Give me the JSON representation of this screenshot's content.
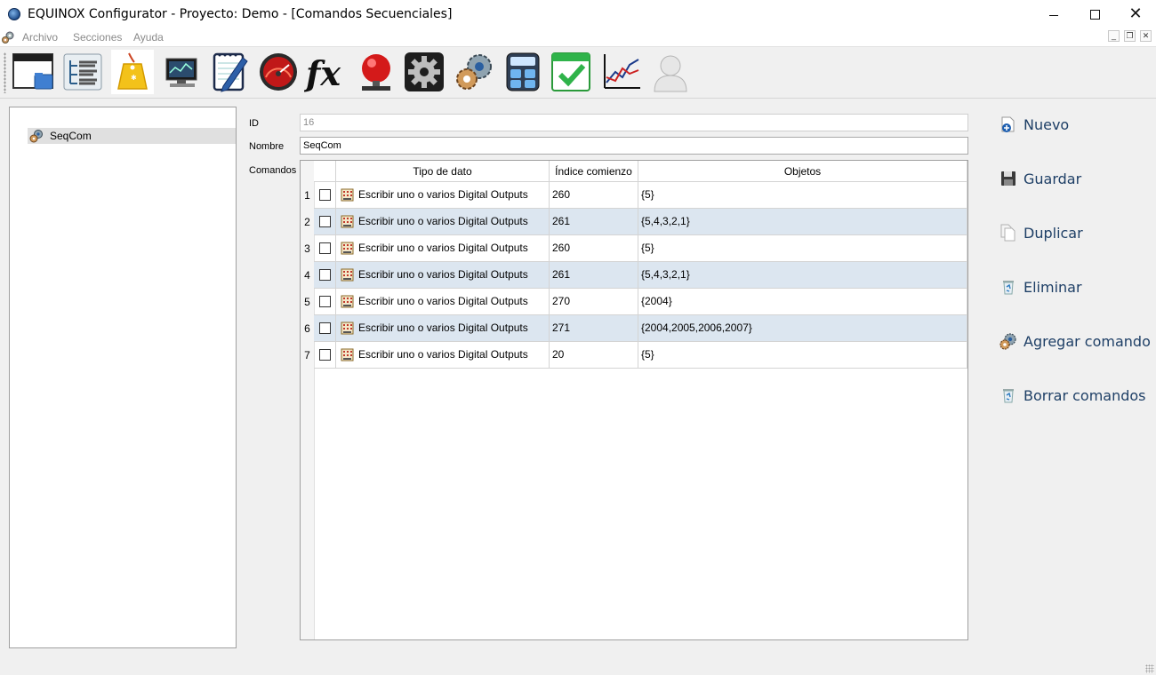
{
  "window": {
    "title": "EQUINOX Configurator - Proyecto: Demo - [Comandos Secuenciales]"
  },
  "menu": {
    "items": [
      "Archivo",
      "Secciones",
      "Ayuda"
    ]
  },
  "toolbar": {
    "icons": [
      "window-icon",
      "tree-list-icon",
      "tag-icon",
      "monitor-icon",
      "notepad-pen-icon",
      "gauge-icon",
      "function-fx-icon",
      "alarm-bell-icon",
      "gear-icon",
      "gears-icon",
      "calculator-icon",
      "calendar-check-icon",
      "line-chart-icon",
      "user-icon"
    ],
    "fx_label": "fx"
  },
  "tree": {
    "items": [
      {
        "label": "SeqCom"
      }
    ]
  },
  "form": {
    "id_label": "ID",
    "id_value": "16",
    "name_label": "Nombre",
    "name_value": "SeqCom",
    "commands_label": "Comandos"
  },
  "grid": {
    "columns": [
      "Tipo de dato",
      "Índice comienzo",
      "Objetos"
    ],
    "rows": [
      {
        "num": "1",
        "type": "Escribir uno o varios Digital Outputs",
        "start": "260",
        "objects": "{5}"
      },
      {
        "num": "2",
        "type": "Escribir uno o varios Digital Outputs",
        "start": "261",
        "objects": "{5,4,3,2,1}"
      },
      {
        "num": "3",
        "type": "Escribir uno o varios Digital Outputs",
        "start": "260",
        "objects": "{5}"
      },
      {
        "num": "4",
        "type": "Escribir uno o varios Digital Outputs",
        "start": "261",
        "objects": "{5,4,3,2,1}"
      },
      {
        "num": "5",
        "type": "Escribir uno o varios Digital Outputs",
        "start": "270",
        "objects": "{2004}"
      },
      {
        "num": "6",
        "type": "Escribir uno o varios Digital Outputs",
        "start": "271",
        "objects": "{2004,2005,2006,2007}"
      },
      {
        "num": "7",
        "type": "Escribir uno o varios Digital Outputs",
        "start": "20",
        "objects": "{5}"
      }
    ]
  },
  "actions": {
    "nuevo": "Nuevo",
    "guardar": "Guardar",
    "duplicar": "Duplicar",
    "eliminar": "Eliminar",
    "agregar": "Agregar comando",
    "borrar": "Borrar comandos"
  },
  "colors": {
    "row_alt": "#dce6f0",
    "action_text": "#1e3f66",
    "selection": "#e0e0e0"
  }
}
